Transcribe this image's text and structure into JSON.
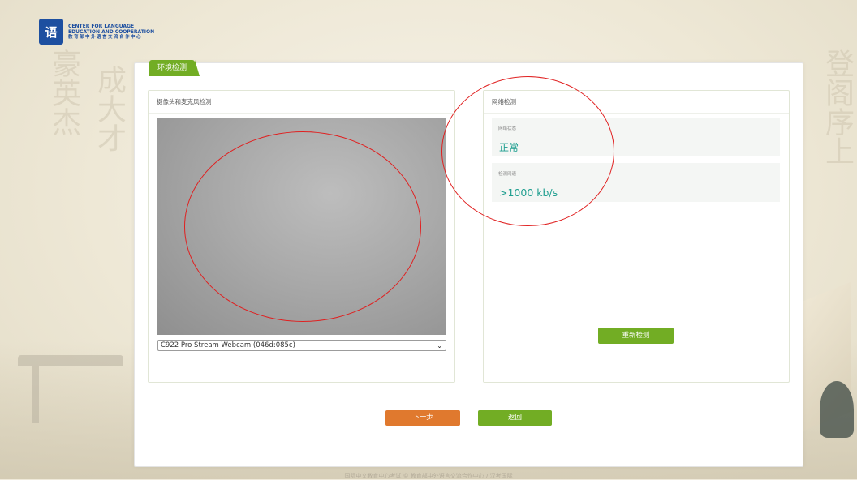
{
  "logo": {
    "mark": "语",
    "line1": "CENTER FOR LANGUAGE",
    "line2": "EDUCATION AND COOPERATION",
    "line3": "教育部中外语言交流合作中心"
  },
  "tab": {
    "label": "环境检测"
  },
  "camera_panel": {
    "title": "摄像头和麦克风检测",
    "select_value": "C922 Pro Stream Webcam (046d:085c)"
  },
  "network_panel": {
    "title": "网络检测",
    "status_label": "网络状态",
    "status_value": "正常",
    "speed_label": "检测网速",
    "speed_value": ">1000 kb/s",
    "retest_label": "重新检测"
  },
  "actions": {
    "next_label": "下一步",
    "back_label": "返回"
  },
  "footer": {
    "text": "国际中文教育中心考试 © 教育部中外语言交流合作中心 / 汉考国际"
  },
  "background_text": {
    "left1": "豪英杰",
    "left2": "成大才",
    "right": "登阁序上"
  },
  "colors": {
    "accent_green": "#72ad24",
    "accent_orange": "#e0792e",
    "value_teal": "#1e9e8f",
    "annotation_red": "#e02020"
  }
}
